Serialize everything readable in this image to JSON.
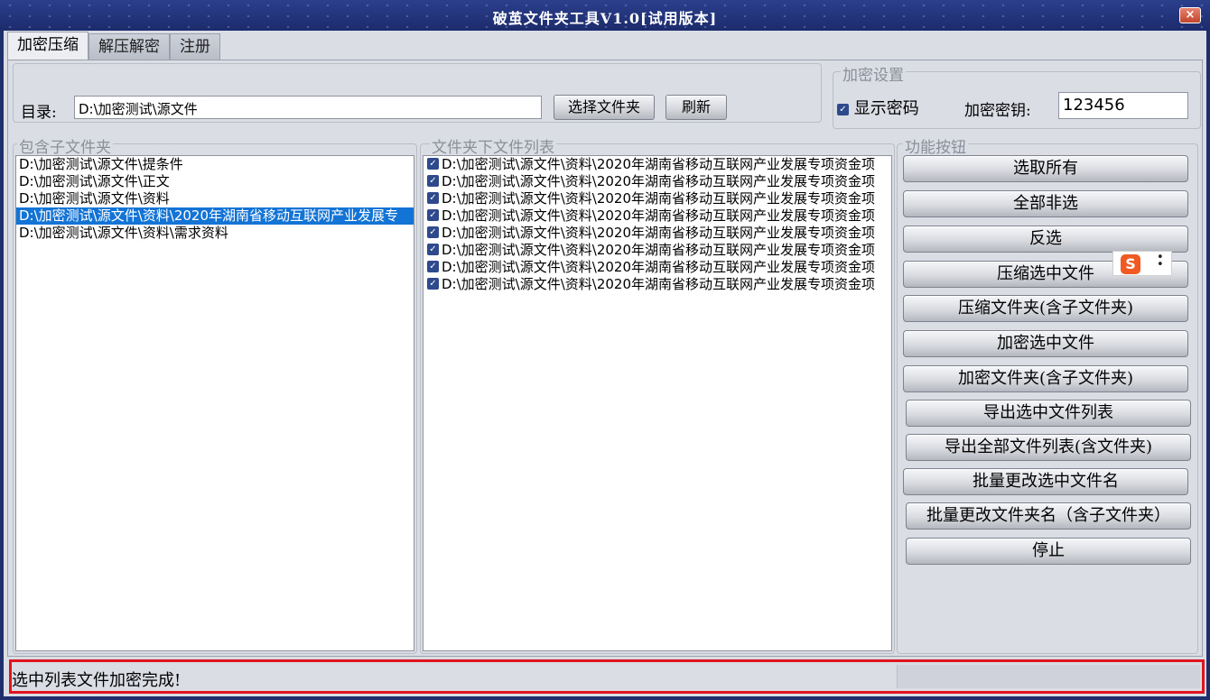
{
  "window": {
    "title": "破茧文件夹工具V1.0[试用版本]",
    "close_label": "×"
  },
  "tabs": [
    {
      "label": "加密压缩",
      "active": true
    },
    {
      "label": "解压解密",
      "active": false
    },
    {
      "label": "注册",
      "active": false
    }
  ],
  "directory": {
    "label": "目录:",
    "value": "D:\\加密测试\\源文件",
    "choose_button": "选择文件夹",
    "refresh_button": "刷新"
  },
  "encryption": {
    "legend": "加密设置",
    "show_password_label": "显示密码",
    "show_password_checked": true,
    "key_label": "加密密钥:",
    "key_value": "123456"
  },
  "subfolders": {
    "legend": "包含子文件夹",
    "items": [
      {
        "text": "D:\\加密测试\\源文件\\提条件",
        "selected": false
      },
      {
        "text": "D:\\加密测试\\源文件\\正文",
        "selected": false
      },
      {
        "text": "D:\\加密测试\\源文件\\资料",
        "selected": false
      },
      {
        "text": "D:\\加密测试\\源文件\\资料\\2020年湖南省移动互联网产业发展专",
        "selected": true
      },
      {
        "text": "D:\\加密测试\\源文件\\资料\\需求资料",
        "selected": false
      }
    ]
  },
  "files": {
    "legend": "文件夹下文件列表",
    "items": [
      "D:\\加密测试\\源文件\\资料\\2020年湖南省移动互联网产业发展专项资金项",
      "D:\\加密测试\\源文件\\资料\\2020年湖南省移动互联网产业发展专项资金项",
      "D:\\加密测试\\源文件\\资料\\2020年湖南省移动互联网产业发展专项资金项",
      "D:\\加密测试\\源文件\\资料\\2020年湖南省移动互联网产业发展专项资金项",
      "D:\\加密测试\\源文件\\资料\\2020年湖南省移动互联网产业发展专项资金项",
      "D:\\加密测试\\源文件\\资料\\2020年湖南省移动互联网产业发展专项资金项",
      "D:\\加密测试\\源文件\\资料\\2020年湖南省移动互联网产业发展专项资金项",
      "D:\\加密测试\\源文件\\资料\\2020年湖南省移动互联网产业发展专项资金项"
    ]
  },
  "functions": {
    "legend": "功能按钮",
    "buttons": [
      "选取所有",
      "全部非选",
      "反选",
      "压缩选中文件",
      "压缩文件夹(含子文件夹)",
      "加密选中文件",
      "加密文件夹(含子文件夹)",
      "导出选中文件列表",
      "导出全部文件列表(含文件夹)",
      "批量更改选中文件名",
      "批量更改文件夹名（含子文件夹）",
      "停止"
    ]
  },
  "ime": {
    "logo": "S",
    "menu_icon": "more-icon"
  },
  "status": {
    "text": "选中列表文件加密完成!"
  },
  "colors": {
    "selection": "#1474d6",
    "titlebar": "#1f2f6e",
    "status_border": "#e0141e"
  }
}
